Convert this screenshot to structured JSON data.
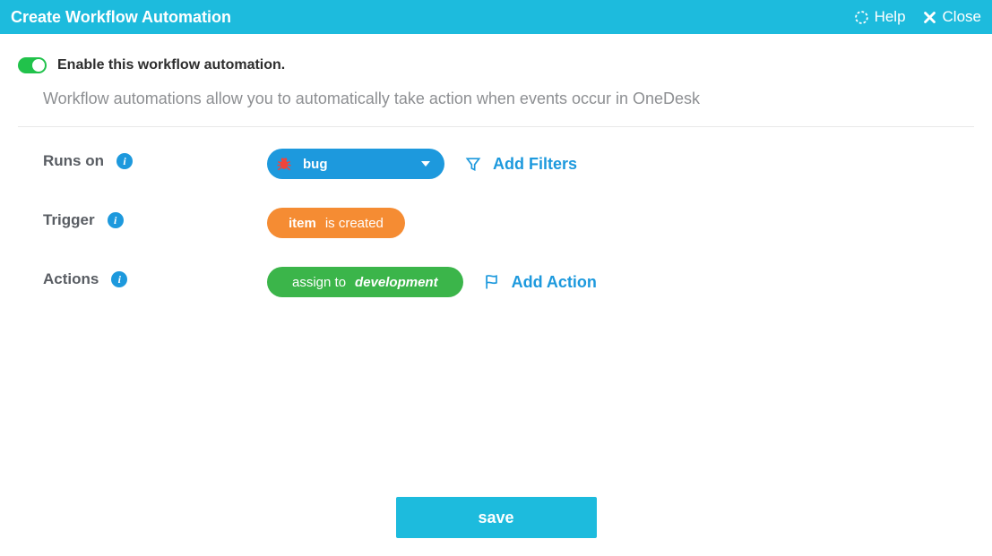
{
  "header": {
    "title": "Create Workflow Automation",
    "help_label": "Help",
    "close_label": "Close"
  },
  "enable": {
    "label": "Enable this workflow automation.",
    "on": true
  },
  "description": "Workflow automations allow you to automatically take action when events occur in OneDesk",
  "rows": {
    "runs_on": {
      "label": "Runs on",
      "selected": "bug",
      "add_filters_label": "Add Filters"
    },
    "trigger": {
      "label": "Trigger",
      "subject": "item",
      "predicate": "is created"
    },
    "actions": {
      "label": "Actions",
      "verb": "assign to",
      "target": "development",
      "add_action_label": "Add Action"
    }
  },
  "footer": {
    "save_label": "save"
  }
}
